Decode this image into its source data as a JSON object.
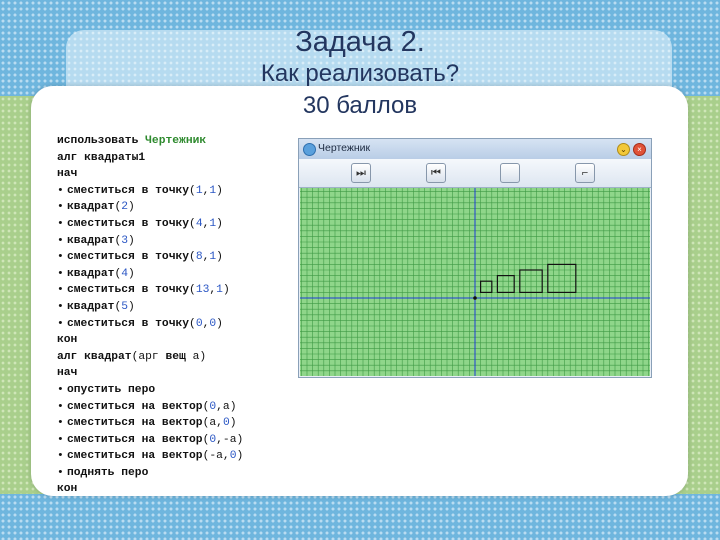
{
  "slide": {
    "title_line1": "Задача 2.",
    "title_line2": "Как реализовать?",
    "title_line3": "30 баллов",
    "colors": {
      "title": "#23365f",
      "grid_fill": "#8fd68a",
      "grid_line": "#3f9a45",
      "axis": "#1f3cd6"
    }
  },
  "code": [
    [
      {
        "t": "использовать ",
        "c": "kw"
      },
      {
        "t": "Чертежник",
        "c": "green"
      }
    ],
    [
      {
        "t": "алг ",
        "c": "kw"
      },
      {
        "t": "квадраты1",
        "c": "kw"
      }
    ],
    [
      {
        "t": "нач",
        "c": "kw"
      }
    ],
    [
      {
        "t": "•",
        "c": "bullet"
      },
      {
        "t": "сместиться в точку",
        "c": "kw"
      },
      {
        "t": "(",
        "c": ""
      },
      {
        "t": "1",
        "c": "num"
      },
      {
        "t": ",",
        "c": ""
      },
      {
        "t": "1",
        "c": "num"
      },
      {
        "t": ")",
        "c": ""
      }
    ],
    [
      {
        "t": "•",
        "c": "bullet"
      },
      {
        "t": "квадрат",
        "c": "kw"
      },
      {
        "t": "(",
        "c": ""
      },
      {
        "t": "2",
        "c": "num"
      },
      {
        "t": ")",
        "c": ""
      }
    ],
    [
      {
        "t": "•",
        "c": "bullet"
      },
      {
        "t": "сместиться в точку",
        "c": "kw"
      },
      {
        "t": "(",
        "c": ""
      },
      {
        "t": "4",
        "c": "num"
      },
      {
        "t": ",",
        "c": ""
      },
      {
        "t": "1",
        "c": "num"
      },
      {
        "t": ")",
        "c": ""
      }
    ],
    [
      {
        "t": "•",
        "c": "bullet"
      },
      {
        "t": "квадрат",
        "c": "kw"
      },
      {
        "t": "(",
        "c": ""
      },
      {
        "t": "3",
        "c": "num"
      },
      {
        "t": ")",
        "c": ""
      }
    ],
    [
      {
        "t": "•",
        "c": "bullet"
      },
      {
        "t": "сместиться в точку",
        "c": "kw"
      },
      {
        "t": "(",
        "c": ""
      },
      {
        "t": "8",
        "c": "num"
      },
      {
        "t": ",",
        "c": ""
      },
      {
        "t": "1",
        "c": "num"
      },
      {
        "t": ")",
        "c": ""
      }
    ],
    [
      {
        "t": "•",
        "c": "bullet"
      },
      {
        "t": "квадрат",
        "c": "kw"
      },
      {
        "t": "(",
        "c": ""
      },
      {
        "t": "4",
        "c": "num"
      },
      {
        "t": ")",
        "c": ""
      }
    ],
    [
      {
        "t": "•",
        "c": "bullet"
      },
      {
        "t": "сместиться в точку",
        "c": "kw"
      },
      {
        "t": "(",
        "c": ""
      },
      {
        "t": "13",
        "c": "num"
      },
      {
        "t": ",",
        "c": ""
      },
      {
        "t": "1",
        "c": "num"
      },
      {
        "t": ")",
        "c": ""
      }
    ],
    [
      {
        "t": "•",
        "c": "bullet"
      },
      {
        "t": "квадрат",
        "c": "kw"
      },
      {
        "t": "(",
        "c": ""
      },
      {
        "t": "5",
        "c": "num"
      },
      {
        "t": ")",
        "c": ""
      }
    ],
    [
      {
        "t": "•",
        "c": "bullet"
      },
      {
        "t": "сместиться в точку",
        "c": "kw"
      },
      {
        "t": "(",
        "c": ""
      },
      {
        "t": "0",
        "c": "num"
      },
      {
        "t": ",",
        "c": ""
      },
      {
        "t": "0",
        "c": "num"
      },
      {
        "t": ")",
        "c": ""
      }
    ],
    [
      {
        "t": "кон",
        "c": "kw"
      }
    ],
    [
      {
        "t": "алг ",
        "c": "kw"
      },
      {
        "t": "квадрат",
        "c": "kw"
      },
      {
        "t": "(арг ",
        "c": ""
      },
      {
        "t": "вещ",
        "c": "kw"
      },
      {
        "t": " a)",
        "c": ""
      }
    ],
    [
      {
        "t": "нач",
        "c": "kw"
      }
    ],
    [
      {
        "t": "•",
        "c": "bullet"
      },
      {
        "t": "опустить перо",
        "c": "kw"
      }
    ],
    [
      {
        "t": "•",
        "c": "bullet"
      },
      {
        "t": "сместиться на вектор",
        "c": "kw"
      },
      {
        "t": "(",
        "c": ""
      },
      {
        "t": "0",
        "c": "num"
      },
      {
        "t": ",a)",
        "c": ""
      }
    ],
    [
      {
        "t": "•",
        "c": "bullet"
      },
      {
        "t": "сместиться на вектор",
        "c": "kw"
      },
      {
        "t": "(a,",
        "c": ""
      },
      {
        "t": "0",
        "c": "num"
      },
      {
        "t": ")",
        "c": ""
      }
    ],
    [
      {
        "t": "•",
        "c": "bullet"
      },
      {
        "t": "сместиться на вектор",
        "c": "kw"
      },
      {
        "t": "(",
        "c": ""
      },
      {
        "t": "0",
        "c": "num"
      },
      {
        "t": ",-a)",
        "c": ""
      }
    ],
    [
      {
        "t": "•",
        "c": "bullet"
      },
      {
        "t": "сместиться на вектор",
        "c": "kw"
      },
      {
        "t": "(-a,",
        "c": ""
      },
      {
        "t": "0",
        "c": "num"
      },
      {
        "t": ")",
        "c": ""
      }
    ],
    [
      {
        "t": "•",
        "c": "bullet"
      },
      {
        "t": "поднять перо",
        "c": "kw"
      }
    ],
    [
      {
        "t": "кон",
        "c": "kw"
      }
    ]
  ],
  "window": {
    "title": "Чертежник",
    "minimize_glyph": "⌄",
    "close_glyph": "×",
    "toolbar": [
      {
        "name": "run-button",
        "icon": "play-next-icon",
        "glyph": "⏭"
      },
      {
        "name": "back-button",
        "icon": "step-back-icon",
        "glyph": "⏮"
      },
      {
        "name": "blank-button",
        "icon": "blank-icon",
        "glyph": ""
      },
      {
        "name": "corner-button",
        "icon": "corner-icon",
        "glyph": "⌐"
      }
    ],
    "drawing": {
      "squares": [
        {
          "x": 1,
          "y": 1,
          "size": 2
        },
        {
          "x": 4,
          "y": 1,
          "size": 3
        },
        {
          "x": 8,
          "y": 1,
          "size": 4
        },
        {
          "x": 13,
          "y": 1,
          "size": 5
        }
      ],
      "origin_marker": {
        "x": 0,
        "y": 0
      }
    }
  }
}
